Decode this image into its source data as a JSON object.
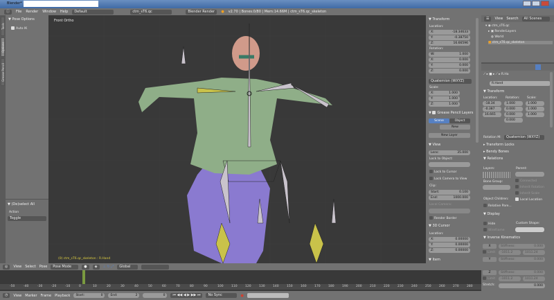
{
  "window": {
    "title": "Blender*"
  },
  "menu": {
    "items": [
      "File",
      "Render",
      "Window",
      "Help"
    ],
    "layout": "Default",
    "scene": "ctm_sT6.qc",
    "engine": "Blender Render",
    "stats": "v2.70 | Bones:0/80 | Mem:14.66M | ctm_sT6.qc_skeleton"
  },
  "toolshelf": {
    "tabs": [
      "Tools",
      "Options",
      "Grease Pencil"
    ],
    "panel": "Pose Options",
    "autoik": "Auto IK",
    "op_title": "(De)select All",
    "action_label": "Action",
    "action": "Toggle"
  },
  "viewport": {
    "label": "Front Ortho",
    "status": "(0) ctm_sT6.qc_skeleton : R.Hand"
  },
  "npanel": {
    "transform": "Transform",
    "location": "Location:",
    "loc": [
      {
        "a": "X:",
        "v": "-18.34633"
      },
      {
        "a": "Y:",
        "v": "-0.38750"
      },
      {
        "a": "Z:",
        "v": "16.66596"
      }
    ],
    "rotation": "Rotation:",
    "rot": [
      {
        "a": "W:",
        "v": "1.000"
      },
      {
        "a": "X:",
        "v": "0.000"
      },
      {
        "a": "Y:",
        "v": "0.000"
      },
      {
        "a": "Z:",
        "v": "0.000"
      }
    ],
    "rotmode": "Quaternion (WXYZ)",
    "scale": "Scale:",
    "scl": [
      {
        "a": "X:",
        "v": "1.000"
      },
      {
        "a": "Y:",
        "v": "1.000"
      },
      {
        "a": "Z:",
        "v": "1.000"
      }
    ],
    "gp": "Grease Pencil Layers",
    "gp_scene": "Scene",
    "gp_object": "Object",
    "gp_new": "New",
    "gp_newlayer": "New Layer",
    "view": "View",
    "lens_label": "Lens:",
    "lens": "35.000",
    "lock_obj": "Lock to Object:",
    "lock_cursor": "Lock to Cursor",
    "lock_camera": "Lock Camera to View",
    "clip": "Clip:",
    "clip_start_l": "Start:",
    "clip_start": "0.100",
    "clip_end_l": "End:",
    "clip_end": "1000.000",
    "local_camera": "Local Camera:",
    "render_border": "Render Border",
    "cursor": "3D Cursor",
    "cursor_loc": "Location:",
    "cur": [
      {
        "a": "X:",
        "v": "0.00000"
      },
      {
        "a": "Y:",
        "v": "0.00000"
      },
      {
        "a": "Z:",
        "v": "0.00000"
      }
    ],
    "item": "Item"
  },
  "outliner": {
    "view": "View",
    "search": "Search",
    "filter": "All Scenes",
    "tree": [
      "ctm_sT6.qc",
      "RenderLayers",
      "World",
      "ctm_sT6.qc_skeleton"
    ]
  },
  "props": {
    "bone_name": "R.Hand",
    "breadcrumb": "R.Ha",
    "transform": "Transform",
    "loc_l": "Location:",
    "rot_l": "Rotation:",
    "scl_l": "Scale:",
    "loc": [
      "-18.34",
      "-0.387",
      "16.665"
    ],
    "rot": [
      "1.000",
      "0.000",
      "0.000",
      "0.000"
    ],
    "scl": [
      "1.000",
      "1.000",
      "1.000"
    ],
    "rotmode_l": "Rotation M:",
    "rotmode": "Quaternion (WXYZ)",
    "transform_locks": "Transform Locks",
    "bendy": "Bendy Bones",
    "relations": "Relations",
    "layers": "Layers:",
    "parent": "Parent:",
    "bone_group": "Bone Group:",
    "connected": "Connected",
    "inherit_rot": "Inherit Rotation",
    "inherit_scale": "Inherit Scale",
    "local_location": "Local Location",
    "obj_children": "Object Children:",
    "relative_parent": "Relative Pare...",
    "display": "Display",
    "hide": "Hide",
    "wireframe": "Wireframe",
    "custom_shape": "Custom Shape:",
    "ik": "Inverse Kinematics",
    "ik_rows": [
      {
        "axis": "X",
        "stiff": "Stiffness:",
        "val": "0.000",
        "lmin": "-1011.2",
        "lmax": "1011.24"
      },
      {
        "axis": "Y",
        "stiff": "Stiffness:",
        "val": "0.000",
        "lmin": "-1011.2",
        "lmax": "1011.24"
      },
      {
        "axis": "Z",
        "stiff": "Stiffness:",
        "val": "0.000",
        "lmin": "-1011.2",
        "lmax": "1011.24"
      }
    ],
    "limit": "Limit",
    "stretch": "Stretch:",
    "stretch_val": "0.000"
  },
  "vhdr": {
    "items": [
      "View",
      "Select",
      "Pose"
    ],
    "mode": "Pose Mode",
    "orientation": "Global"
  },
  "timeline": {
    "ticks": [
      "-50",
      "-40",
      "-30",
      "-20",
      "-10",
      "0",
      "10",
      "20",
      "30",
      "40",
      "50",
      "60",
      "70",
      "80",
      "90",
      "100",
      "110",
      "120",
      "130",
      "140",
      "150",
      "160",
      "170",
      "180",
      "190",
      "200",
      "210",
      "220",
      "230",
      "240",
      "250",
      "260",
      "270",
      "280"
    ],
    "current_frame": 0,
    "menu": [
      "View",
      "Marker",
      "Frame",
      "Playback"
    ],
    "start_l": "Start:",
    "start": "0",
    "end_l": "End:",
    "end": "2",
    "frame": "0",
    "sync": "No Sync"
  },
  "colors": {
    "accent": "#5680c2",
    "bone_yellow": "#c9c24a",
    "mesh_green": "#8fae88",
    "mesh_purple": "#8a7ad0"
  }
}
